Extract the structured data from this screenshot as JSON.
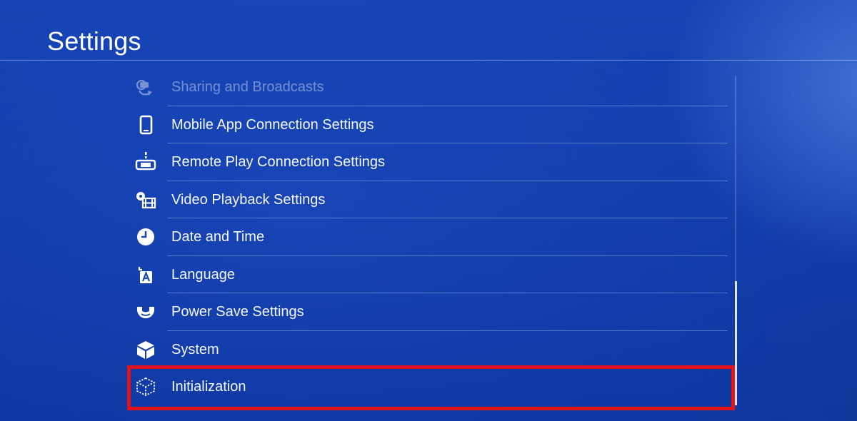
{
  "header": {
    "title": "Settings"
  },
  "menu": {
    "items": [
      {
        "label": "Sharing and Broadcasts",
        "icon": "sharing-broadcast-icon",
        "state": "faded"
      },
      {
        "label": "Mobile App Connection Settings",
        "icon": "mobile-phone-icon"
      },
      {
        "label": "Remote Play Connection Settings",
        "icon": "remote-play-icon"
      },
      {
        "label": "Video Playback Settings",
        "icon": "video-playback-icon"
      },
      {
        "label": "Date and Time",
        "icon": "clock-icon"
      },
      {
        "label": "Language",
        "icon": "language-icon"
      },
      {
        "label": "Power Save Settings",
        "icon": "power-save-icon"
      },
      {
        "label": "System",
        "icon": "system-cube-icon"
      },
      {
        "label": "Initialization",
        "icon": "initialization-icon",
        "state": "highlighted"
      }
    ]
  },
  "scrollbar": {
    "position": 0.82,
    "visible_fraction": 0.38
  },
  "colors": {
    "background": "#133fad",
    "text": "#f4f7ff",
    "highlight_border": "#e3121b",
    "divider": "#a0beff"
  }
}
